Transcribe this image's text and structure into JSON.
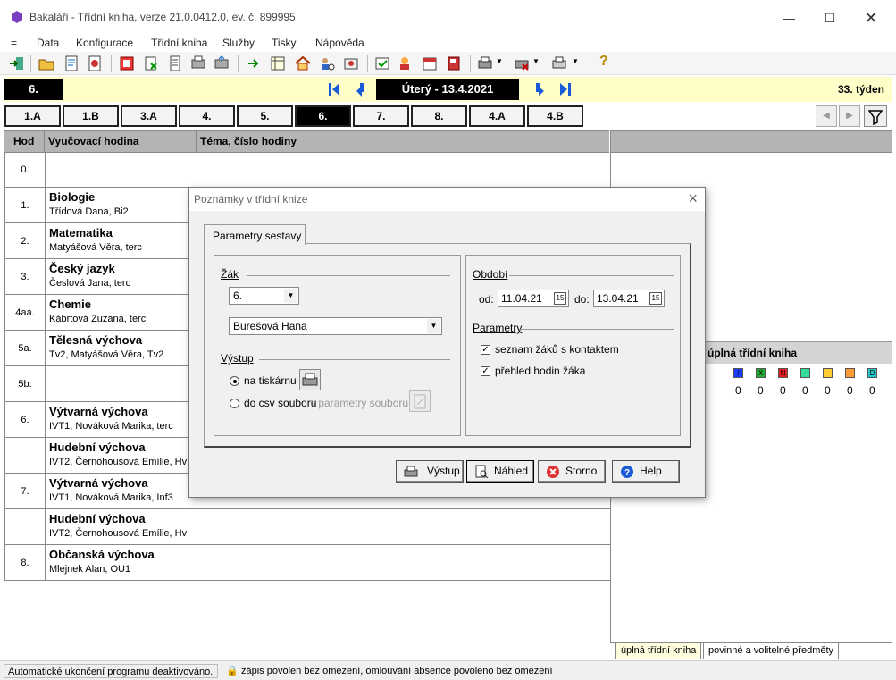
{
  "window": {
    "title": "Bakaláři - Třídní kniha, verze 21.0.0412.0, ev. č. 899995"
  },
  "menu": [
    "=",
    "Data",
    "Konfigurace",
    "Třídní kniha",
    "Služby",
    "Tisky",
    "Nápověda"
  ],
  "datebar": {
    "class": "6.",
    "date": "Úterý - 13.4.2021",
    "week": "33. týden"
  },
  "class_tabs": [
    "1.A",
    "1.B",
    "3.A",
    "4.",
    "5.",
    "6.",
    "7.",
    "8.",
    "4.A",
    "4.B"
  ],
  "active_tab": "6.",
  "grid": {
    "headers": [
      "Hod",
      "Vyučovací hodina",
      "Téma, číslo hodiny"
    ],
    "rows": [
      {
        "hod": "0.",
        "subject": "",
        "teacher": ""
      },
      {
        "hod": "1.",
        "subject": "Biologie",
        "teacher": "Třídová Dana, Bi2"
      },
      {
        "hod": "2.",
        "subject": "Matematika",
        "teacher": "Matyášová Věra, terc"
      },
      {
        "hod": "3.",
        "subject": "Český jazyk",
        "teacher": "Česlová Jana, terc"
      },
      {
        "hod": "4aa.",
        "subject": "Chemie",
        "teacher": "Kábrtová Zuzana, terc"
      },
      {
        "hod": "5a.",
        "subject": "Tělesná výchova",
        "teacher": "Tv2, Matyášová Věra, Tv2"
      },
      {
        "hod": "5b.",
        "subject": "",
        "teacher": ""
      },
      {
        "hod": "6.",
        "subject": "Výtvarná výchova",
        "teacher": "IVT1, Nováková Marika, terc"
      },
      {
        "hod": "",
        "subject": "Hudební výchova",
        "teacher": "IVT2, Černohousová Emílie, Hv"
      },
      {
        "hod": "7.",
        "subject": "Výtvarná výchova",
        "teacher": "IVT1, Nováková Marika, Inf3"
      },
      {
        "hod": "",
        "subject": "Hudební výchova",
        "teacher": "IVT2, Černohousová Emílie, Hv"
      },
      {
        "hod": "8.",
        "subject": "Občanská výchova",
        "teacher": "Mlejnek Alan, OU1"
      }
    ]
  },
  "right_pane": {
    "subtitle": "úplná třídní kniha",
    "chips": [
      {
        "label": "/",
        "color": "#1a3cff"
      },
      {
        "label": "X",
        "color": "#22aa33"
      },
      {
        "label": "N",
        "color": "#e82020"
      },
      {
        "label": "",
        "color": "#33dd99"
      },
      {
        "label": "",
        "color": "#ffcc33"
      },
      {
        "label": "",
        "color": "#ff9933"
      },
      {
        "label": "D",
        "color": "#22cccc"
      }
    ],
    "counts": [
      "0",
      "0",
      "0",
      "0",
      "0",
      "0",
      "0"
    ],
    "tabs": [
      "úplná třídní kniha",
      "povinné a volitelné předměty"
    ]
  },
  "status": {
    "left": "Automatické ukončení programu deaktivováno.",
    "right": "zápis povolen bez omezení, omlouvání absence povoleno bez omezení"
  },
  "dialog": {
    "title": "Poznámky v třídní knize",
    "tab": "Parametry sestavy",
    "zak_label": "Žák",
    "class_value": "6.",
    "student_value": "Burešová Hana",
    "vystup_label": "Výstup",
    "radio_printer": "na tiskárnu",
    "radio_csv": "do csv souboru",
    "csv_params": "- parametry souboru",
    "obdobi_label": "Období",
    "od_label": "od:",
    "od_value": "11.04.21",
    "do_label": "do:",
    "do_value": "13.04.21",
    "parametry_label": "Parametry",
    "check1": "seznam žáků s kontaktem",
    "check2": "přehled hodin žáka",
    "buttons": {
      "vystup": "Výstup",
      "nahled": "Náhled",
      "storno": "Storno",
      "help": "Help"
    }
  }
}
